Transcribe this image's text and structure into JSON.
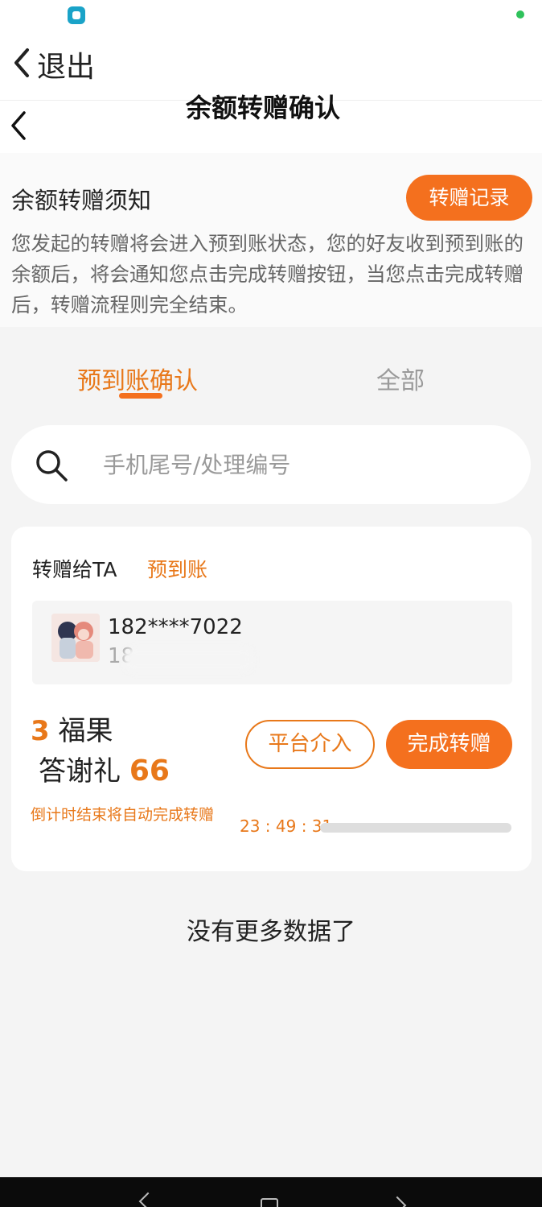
{
  "exit_bar": {
    "label": "退出"
  },
  "nav": {
    "title": "余额转赠确认"
  },
  "notice": {
    "title": "余额转赠须知",
    "record_button": "转赠记录",
    "body": "您发起的转赠将会进入预到账状态，您的好友收到预到账的余额后，将会通知您点击完成转赠按钮，当您点击完成转赠后，转赠流程则完全结束。"
  },
  "tabs": [
    {
      "label": "预到账确认",
      "active": true
    },
    {
      "label": "全部",
      "active": false
    }
  ],
  "search": {
    "placeholder": "手机尾号/处理编号"
  },
  "card": {
    "recipient_label": "转赠给TA",
    "status": "预到账",
    "phone_primary": "182****7022",
    "phone_secondary_visible": "18",
    "amount_value": "3",
    "amount_unit": "福果",
    "thanks_label": "答谢礼",
    "thanks_value": "66",
    "intervene_button": "平台介入",
    "complete_button": "完成转赠",
    "countdown_note": "倒计时结束将自动完成转赠",
    "countdown_time": "23 : 49 : 31"
  },
  "footer": {
    "no_more": "没有更多数据了"
  },
  "colors": {
    "accent": "#f4701e",
    "accent_text": "#e8781a"
  }
}
